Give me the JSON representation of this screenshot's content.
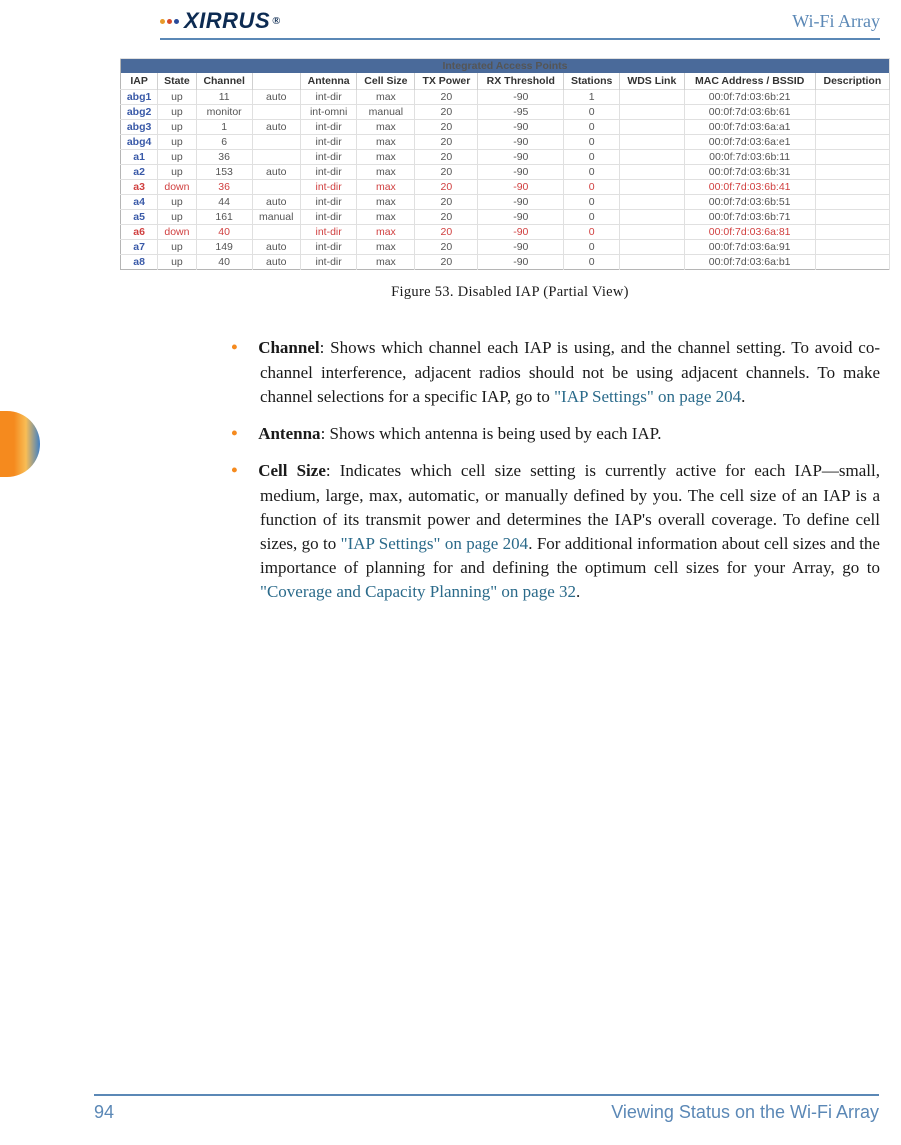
{
  "header": {
    "brand": "XIRRUS",
    "doc_title": "Wi-Fi Array",
    "logo_dot_colors": [
      "#e89a2a",
      "#d64a2a",
      "#2a4a9a"
    ]
  },
  "table": {
    "title": "Integrated Access Points",
    "headers": [
      "IAP",
      "State",
      "Channel",
      "",
      "Antenna",
      "Cell Size",
      "TX Power",
      "RX Threshold",
      "Stations",
      "WDS Link",
      "MAC Address / BSSID",
      "Description"
    ],
    "rows": [
      {
        "iap": "abg1",
        "state": "up",
        "ch": "11",
        "mode": "auto",
        "ant": "int-dir",
        "cell": "max",
        "tx": "20",
        "rx": "-90",
        "sta": "1",
        "wds": "",
        "mac": "00:0f:7d:03:6b:21",
        "desc": "",
        "down": false
      },
      {
        "iap": "abg2",
        "state": "up",
        "ch": "monitor",
        "mode": "",
        "ant": "int-omni",
        "cell": "manual",
        "tx": "20",
        "rx": "-95",
        "sta": "0",
        "wds": "",
        "mac": "00:0f:7d:03:6b:61",
        "desc": "",
        "down": false
      },
      {
        "iap": "abg3",
        "state": "up",
        "ch": "1",
        "mode": "auto",
        "ant": "int-dir",
        "cell": "max",
        "tx": "20",
        "rx": "-90",
        "sta": "0",
        "wds": "",
        "mac": "00:0f:7d:03:6a:a1",
        "desc": "",
        "down": false
      },
      {
        "iap": "abg4",
        "state": "up",
        "ch": "6",
        "mode": "",
        "ant": "int-dir",
        "cell": "max",
        "tx": "20",
        "rx": "-90",
        "sta": "0",
        "wds": "",
        "mac": "00:0f:7d:03:6a:e1",
        "desc": "",
        "down": false
      },
      {
        "iap": "a1",
        "state": "up",
        "ch": "36",
        "mode": "",
        "ant": "int-dir",
        "cell": "max",
        "tx": "20",
        "rx": "-90",
        "sta": "0",
        "wds": "",
        "mac": "00:0f:7d:03:6b:11",
        "desc": "",
        "down": false
      },
      {
        "iap": "a2",
        "state": "up",
        "ch": "153",
        "mode": "auto",
        "ant": "int-dir",
        "cell": "max",
        "tx": "20",
        "rx": "-90",
        "sta": "0",
        "wds": "",
        "mac": "00:0f:7d:03:6b:31",
        "desc": "",
        "down": false
      },
      {
        "iap": "a3",
        "state": "down",
        "ch": "36",
        "mode": "",
        "ant": "int-dir",
        "cell": "max",
        "tx": "20",
        "rx": "-90",
        "sta": "0",
        "wds": "",
        "mac": "00:0f:7d:03:6b:41",
        "desc": "",
        "down": true
      },
      {
        "iap": "a4",
        "state": "up",
        "ch": "44",
        "mode": "auto",
        "ant": "int-dir",
        "cell": "max",
        "tx": "20",
        "rx": "-90",
        "sta": "0",
        "wds": "",
        "mac": "00:0f:7d:03:6b:51",
        "desc": "",
        "down": false
      },
      {
        "iap": "a5",
        "state": "up",
        "ch": "161",
        "mode": "manual",
        "ant": "int-dir",
        "cell": "max",
        "tx": "20",
        "rx": "-90",
        "sta": "0",
        "wds": "",
        "mac": "00:0f:7d:03:6b:71",
        "desc": "",
        "down": false
      },
      {
        "iap": "a6",
        "state": "down",
        "ch": "40",
        "mode": "",
        "ant": "int-dir",
        "cell": "max",
        "tx": "20",
        "rx": "-90",
        "sta": "0",
        "wds": "",
        "mac": "00:0f:7d:03:6a:81",
        "desc": "",
        "down": true
      },
      {
        "iap": "a7",
        "state": "up",
        "ch": "149",
        "mode": "auto",
        "ant": "int-dir",
        "cell": "max",
        "tx": "20",
        "rx": "-90",
        "sta": "0",
        "wds": "",
        "mac": "00:0f:7d:03:6a:91",
        "desc": "",
        "down": false
      },
      {
        "iap": "a8",
        "state": "up",
        "ch": "40",
        "mode": "auto",
        "ant": "int-dir",
        "cell": "max",
        "tx": "20",
        "rx": "-90",
        "sta": "0",
        "wds": "",
        "mac": "00:0f:7d:03:6a:b1",
        "desc": "",
        "down": false
      }
    ]
  },
  "caption": "Figure 53. Disabled IAP (Partial View)",
  "bullets": [
    {
      "title": "Channel",
      "body": ": Shows which channel each IAP is using, and the channel setting. To avoid co-channel interference, adjacent radios should not be using adjacent channels. To make channel selections for a specific IAP, go to ",
      "link": "\"IAP Settings\" on page 204",
      "after_link": "."
    },
    {
      "title": "Antenna",
      "body": ": Shows which antenna is being used by each IAP.",
      "link": "",
      "after_link": ""
    },
    {
      "title": "Cell Size",
      "body": ": Indicates which cell size setting is currently active for each IAP—small, medium, large, max, automatic, or manually defined by you. The cell size of an IAP is a function of its transmit power and determines the IAP's overall coverage. To define cell sizes, go to ",
      "link": "\"IAP Settings\" on page 204",
      "after_link": ". For additional information about cell sizes and the importance of planning for and defining the optimum cell sizes for your Array, go to ",
      "link2": "\"Coverage and Capacity Planning\" on page 32",
      "after_link2": "."
    }
  ],
  "footer": {
    "page": "94",
    "section": "Viewing Status on the Wi-Fi Array"
  }
}
